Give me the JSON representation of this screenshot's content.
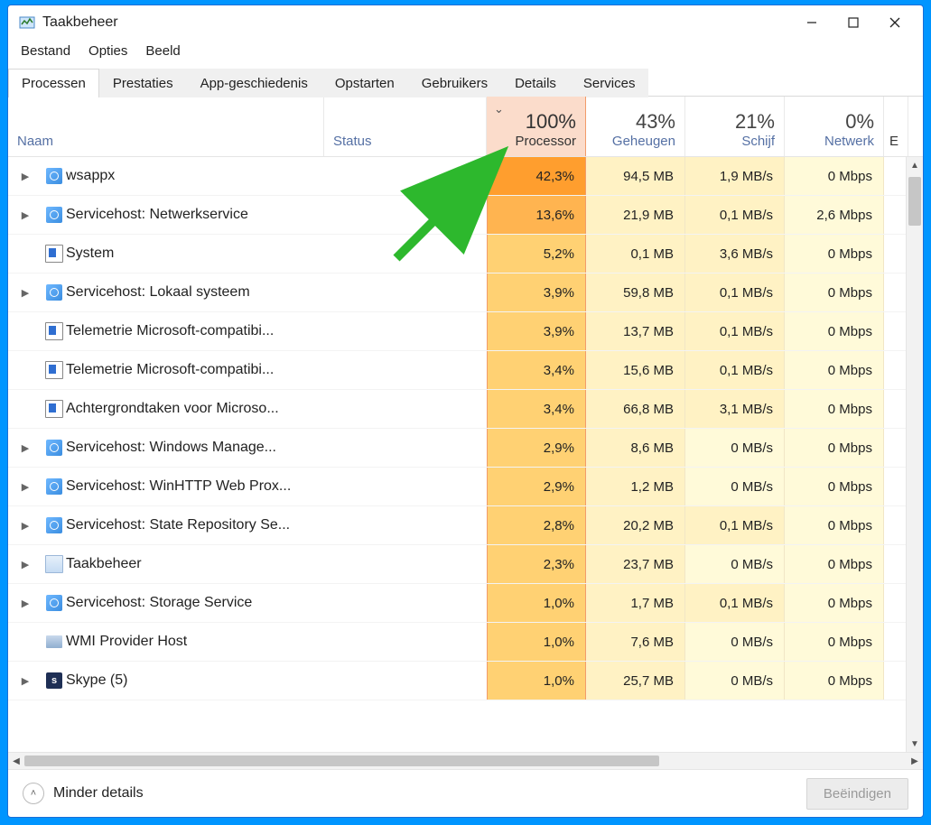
{
  "window": {
    "title": "Taakbeheer"
  },
  "menu": [
    "Bestand",
    "Opties",
    "Beeld"
  ],
  "tabs": [
    "Processen",
    "Prestaties",
    "App-geschiedenis",
    "Opstarten",
    "Gebruikers",
    "Details",
    "Services"
  ],
  "active_tab": 0,
  "columns": {
    "name": "Naam",
    "status": "Status",
    "proc_big": "100%",
    "proc_lbl": "Processor",
    "mem_big": "43%",
    "mem_lbl": "Geheugen",
    "dsk_big": "21%",
    "dsk_lbl": "Schijf",
    "net_big": "0%",
    "net_lbl": "Netwerk",
    "overflow": "E"
  },
  "rows": [
    {
      "exp": true,
      "icon": "gear",
      "name": "wsappx",
      "proc": "42,3%",
      "proc_heat": "vh",
      "mem": "94,5 MB",
      "dsk": "1,9 MB/s",
      "net": "0 Mbps"
    },
    {
      "exp": true,
      "icon": "gear",
      "name": "Servicehost: Netwerkservice",
      "proc": "13,6%",
      "proc_heat": "h",
      "mem": "21,9 MB",
      "dsk": "0,1 MB/s",
      "net": "2,6 Mbps"
    },
    {
      "exp": false,
      "icon": "sq",
      "name": "System",
      "proc": "5,2%",
      "mem": "0,1 MB",
      "dsk": "3,6 MB/s",
      "net": "0 Mbps"
    },
    {
      "exp": true,
      "icon": "gear",
      "name": "Servicehost: Lokaal systeem",
      "proc": "3,9%",
      "mem": "59,8 MB",
      "dsk": "0,1 MB/s",
      "net": "0 Mbps"
    },
    {
      "exp": false,
      "icon": "sq",
      "name": "Telemetrie Microsoft-compatibi...",
      "proc": "3,9%",
      "mem": "13,7 MB",
      "dsk": "0,1 MB/s",
      "net": "0 Mbps"
    },
    {
      "exp": false,
      "icon": "sq",
      "name": "Telemetrie Microsoft-compatibi...",
      "proc": "3,4%",
      "mem": "15,6 MB",
      "dsk": "0,1 MB/s",
      "net": "0 Mbps"
    },
    {
      "exp": false,
      "icon": "sq",
      "name": "Achtergrondtaken voor Microso...",
      "proc": "3,4%",
      "mem": "66,8 MB",
      "dsk": "3,1 MB/s",
      "net": "0 Mbps"
    },
    {
      "exp": true,
      "icon": "gear",
      "name": "Servicehost: Windows Manage...",
      "proc": "2,9%",
      "mem": "8,6 MB",
      "dsk": "0 MB/s",
      "dsk_zero": true,
      "net": "0 Mbps"
    },
    {
      "exp": true,
      "icon": "gear",
      "name": "Servicehost: WinHTTP Web Prox...",
      "proc": "2,9%",
      "mem": "1,2 MB",
      "dsk": "0 MB/s",
      "dsk_zero": true,
      "net": "0 Mbps"
    },
    {
      "exp": true,
      "icon": "gear",
      "name": "Servicehost: State Repository Se...",
      "proc": "2,8%",
      "mem": "20,2 MB",
      "dsk": "0,1 MB/s",
      "net": "0 Mbps"
    },
    {
      "exp": true,
      "icon": "tm",
      "name": "Taakbeheer",
      "proc": "2,3%",
      "mem": "23,7 MB",
      "dsk": "0 MB/s",
      "dsk_zero": true,
      "net": "0 Mbps"
    },
    {
      "exp": true,
      "icon": "gear",
      "name": "Servicehost: Storage Service",
      "proc": "1,0%",
      "mem": "1,7 MB",
      "dsk": "0,1 MB/s",
      "net": "0 Mbps"
    },
    {
      "exp": false,
      "icon": "wmi",
      "name": "WMI Provider Host",
      "proc": "1,0%",
      "mem": "7,6 MB",
      "dsk": "0 MB/s",
      "dsk_zero": true,
      "net": "0 Mbps"
    },
    {
      "exp": true,
      "icon": "skype",
      "name": "Skype (5)",
      "proc": "1,0%",
      "mem": "25,7 MB",
      "dsk": "0 MB/s",
      "dsk_zero": true,
      "net": "0 Mbps"
    }
  ],
  "footer": {
    "fewer": "Minder details",
    "end": "Beëindigen"
  }
}
